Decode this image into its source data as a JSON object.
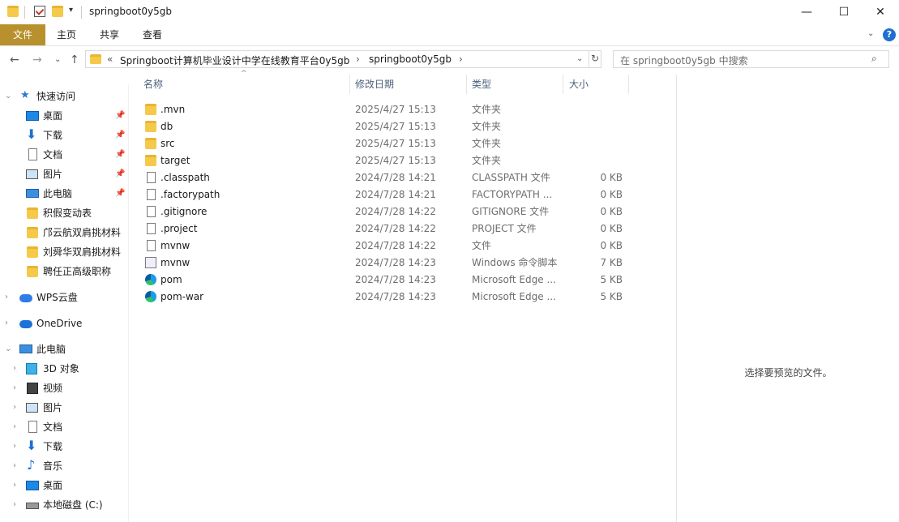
{
  "window": {
    "title": "springboot0y5gb",
    "minimize_glyph": "—",
    "maximize_glyph": "☐",
    "close_glyph": "✕"
  },
  "ribbon": {
    "tabs": [
      "文件",
      "主页",
      "共享",
      "查看"
    ],
    "help_glyph": "?"
  },
  "address": {
    "chevron": "«",
    "crumbs": [
      "Springboot计算机毕业设计中学在线教育平台0y5gb",
      "springboot0y5gb"
    ],
    "separator": "›"
  },
  "search": {
    "placeholder": "在 springboot0y5gb 中搜索"
  },
  "sidebar": {
    "quick_access": "快速访问",
    "pinned": [
      {
        "label": "桌面",
        "icon": "desktop-icon"
      },
      {
        "label": "下载",
        "icon": "download-icon"
      },
      {
        "label": "文档",
        "icon": "document-icon"
      },
      {
        "label": "图片",
        "icon": "picture-icon"
      },
      {
        "label": "此电脑",
        "icon": "computer-icon"
      }
    ],
    "recent": [
      "积假变动表",
      "邝云航双肩挑材料",
      "刘舜华双肩挑材料",
      "聘任正高级职称"
    ],
    "wps": "WPS云盘",
    "onedrive": "OneDrive",
    "this_pc": "此电脑",
    "pc_items": [
      {
        "label": "3D 对象",
        "icon": "3d-objects-icon"
      },
      {
        "label": "视频",
        "icon": "video-icon"
      },
      {
        "label": "图片",
        "icon": "picture-icon"
      },
      {
        "label": "文档",
        "icon": "document-icon"
      },
      {
        "label": "下载",
        "icon": "download-icon"
      },
      {
        "label": "音乐",
        "icon": "music-icon"
      },
      {
        "label": "桌面",
        "icon": "desktop-icon"
      },
      {
        "label": "本地磁盘 (C:)",
        "icon": "drive-icon"
      }
    ]
  },
  "columns": [
    "名称",
    "修改日期",
    "类型",
    "大小"
  ],
  "files": [
    {
      "name": ".mvn",
      "date": "2025/4/27 15:13",
      "type": "文件夹",
      "size": "",
      "icon": "folder-icon"
    },
    {
      "name": "db",
      "date": "2025/4/27 15:13",
      "type": "文件夹",
      "size": "",
      "icon": "folder-icon"
    },
    {
      "name": "src",
      "date": "2025/4/27 15:13",
      "type": "文件夹",
      "size": "",
      "icon": "folder-icon"
    },
    {
      "name": "target",
      "date": "2025/4/27 15:13",
      "type": "文件夹",
      "size": "",
      "icon": "folder-icon"
    },
    {
      "name": ".classpath",
      "date": "2024/7/28 14:21",
      "type": "CLASSPATH 文件",
      "size": "0 KB",
      "icon": "file-icon"
    },
    {
      "name": ".factorypath",
      "date": "2024/7/28 14:21",
      "type": "FACTORYPATH ...",
      "size": "0 KB",
      "icon": "file-icon"
    },
    {
      "name": ".gitignore",
      "date": "2024/7/28 14:22",
      "type": "GITIGNORE 文件",
      "size": "0 KB",
      "icon": "file-icon"
    },
    {
      "name": ".project",
      "date": "2024/7/28 14:22",
      "type": "PROJECT 文件",
      "size": "0 KB",
      "icon": "file-icon"
    },
    {
      "name": "mvnw",
      "date": "2024/7/28 14:22",
      "type": "文件",
      "size": "0 KB",
      "icon": "file-icon"
    },
    {
      "name": "mvnw",
      "date": "2024/7/28 14:23",
      "type": "Windows 命令脚本",
      "size": "7 KB",
      "icon": "script-icon"
    },
    {
      "name": "pom",
      "date": "2024/7/28 14:23",
      "type": "Microsoft Edge ...",
      "size": "5 KB",
      "icon": "edge-icon"
    },
    {
      "name": "pom-war",
      "date": "2024/7/28 14:23",
      "type": "Microsoft Edge ...",
      "size": "5 KB",
      "icon": "edge-icon"
    }
  ],
  "preview": {
    "message": "选择要预览的文件。"
  }
}
